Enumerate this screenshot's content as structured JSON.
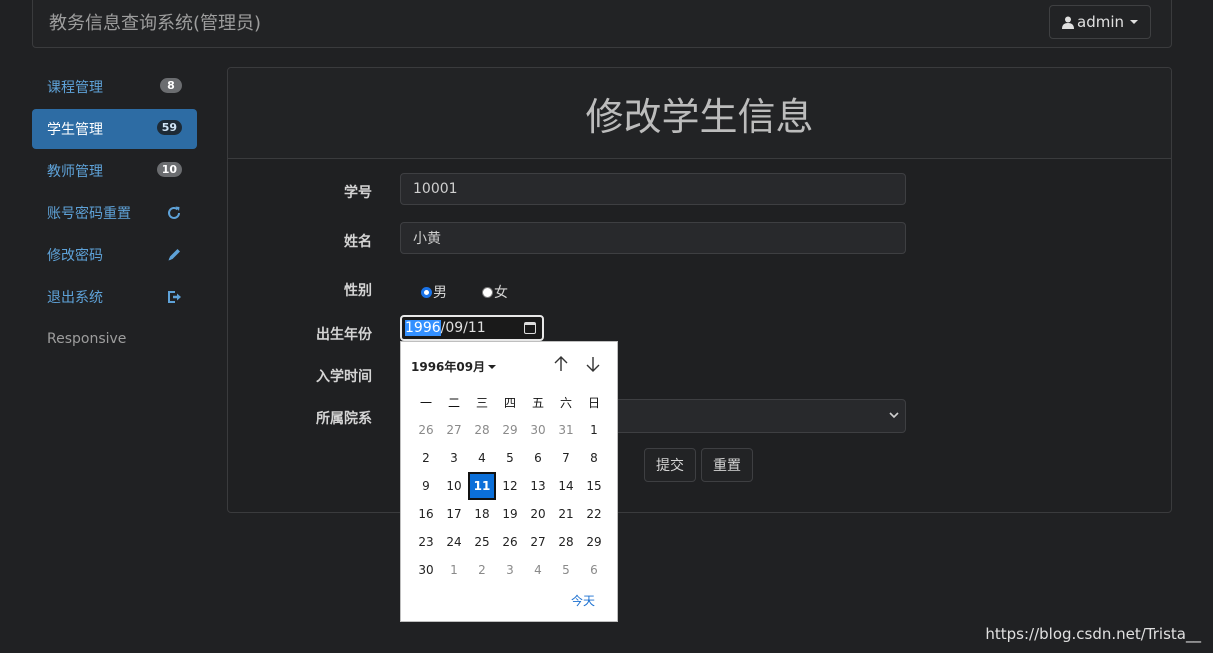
{
  "navbar": {
    "brand": "教务信息查询系统(管理员)",
    "user_label": "admin"
  },
  "sidebar": {
    "items": [
      {
        "label": "课程管理",
        "badge": "8"
      },
      {
        "label": "学生管理",
        "badge": "59"
      },
      {
        "label": "教师管理",
        "badge": "10"
      },
      {
        "label": "账号密码重置"
      },
      {
        "label": "修改密码"
      },
      {
        "label": "退出系统"
      },
      {
        "label": "Responsive"
      }
    ]
  },
  "form": {
    "title": "修改学生信息",
    "student_id_label": "学号",
    "student_id_value": "10001",
    "name_label": "姓名",
    "name_value": "小黄",
    "gender_label": "性别",
    "gender_male": "男",
    "gender_female": "女",
    "birth_label": "出生年份",
    "birth_year": "1996",
    "birth_rest": "/09/11",
    "enroll_label": "入学时间",
    "dept_label": "所属院系",
    "submit_label": "提交",
    "reset_label": "重置"
  },
  "datepicker": {
    "month_label": "1996年09月",
    "weekdays": [
      "一",
      "二",
      "三",
      "四",
      "五",
      "六",
      "日"
    ],
    "weeks": [
      [
        "26",
        "27",
        "28",
        "29",
        "30",
        "31",
        "1"
      ],
      [
        "2",
        "3",
        "4",
        "5",
        "6",
        "7",
        "8"
      ],
      [
        "9",
        "10",
        "11",
        "12",
        "13",
        "14",
        "15"
      ],
      [
        "16",
        "17",
        "18",
        "19",
        "20",
        "21",
        "22"
      ],
      [
        "23",
        "24",
        "25",
        "26",
        "27",
        "28",
        "29"
      ],
      [
        "30",
        "1",
        "2",
        "3",
        "4",
        "5",
        "6"
      ]
    ],
    "today_label": "今天"
  },
  "watermark": "https://blog.csdn.net/Trista__",
  "colors": {
    "accent": "#2d6ca4",
    "link": "#5ea2d8",
    "selected_day": "#0b6fd9"
  }
}
